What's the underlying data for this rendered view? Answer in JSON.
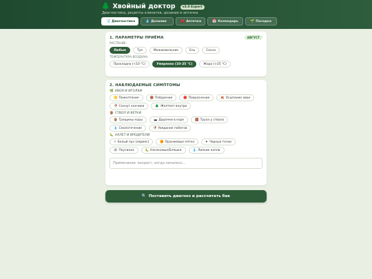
{
  "header": {
    "title": "Хвойный доктор",
    "version": "v3.0 Expert",
    "subtitle": "Диагностика, рецепты клинатов, дозание и аптечка"
  },
  "tabs": [
    {
      "icon": "🩺",
      "label": "Диагностика",
      "active": true
    },
    {
      "icon": "💧",
      "label": "Дозание"
    },
    {
      "icon": "🧰",
      "label": "Аптечка"
    },
    {
      "icon": "📅",
      "label": "Календарь"
    },
    {
      "icon": "🌱",
      "label": "Посадка"
    }
  ],
  "params": {
    "title": "1. ПАРАМЕТРЫ ПРИЁМА",
    "season_badge": "АВГУСТ",
    "plant_label": "РАСТЕНИЕ:",
    "plants": [
      "Любые",
      "Туя",
      "Можжевельник",
      "Ель",
      "Сосна"
    ],
    "temp_label": "ТЕМПЕРАТУРА ВОЗДУХА:",
    "temps": [
      "Прохладно (<10 °C)",
      "Умеренно (10–25 °C)",
      "Жара (>25 °C)"
    ]
  },
  "symptoms": {
    "title": "2. НАБЛЮДАЕМЫЕ СИМПТОМЫ",
    "needles_label": "ХВОЯ И ИГОЛКИ",
    "needles": [
      {
        "icon": "🟡",
        "label": "Пожелтение"
      },
      {
        "icon": "🟤",
        "label": "Побурение"
      },
      {
        "icon": "🔴",
        "label": "Покраснение"
      },
      {
        "icon": "🍂",
        "label": "Осыпание хвои"
      },
      {
        "icon": "🥀",
        "label": "Сохнут кончики"
      },
      {
        "icon": "🌲",
        "label": "Желтеет внутри"
      }
    ],
    "stem_label": "СТВОЛ И ВЕТКИ",
    "stem": [
      {
        "icon": "🪵",
        "label": "Трещины коры"
      },
      {
        "icon": "🕳️",
        "label": "Дырочки в коре"
      },
      {
        "icon": "🟫",
        "label": "Труха у ствола"
      },
      {
        "icon": "💧",
        "label": "Смолотечение"
      },
      {
        "icon": "🥀",
        "label": "Увядание побегов"
      }
    ],
    "pests_label": "НАЛЕТ И ВРЕДИТЕЛИ",
    "pests": [
      {
        "icon": "⚪",
        "label": "Белый пух (хермес)"
      },
      {
        "icon": "🟠",
        "label": "Оранжевые пятна"
      },
      {
        "icon": "⚫",
        "label": "Черные точки"
      },
      {
        "icon": "🕸️",
        "label": "Паутинка"
      },
      {
        "icon": "🐛",
        "label": "Насекомые/Бляшки"
      },
      {
        "icon": "💧",
        "label": "Липкие капли"
      }
    ],
    "note_placeholder": "Примечание: возраст, когда началось..."
  },
  "submit_label": "Поставить диагноз и рассчитать бак",
  "colors": {
    "primary": "#2f5d3a",
    "header": "#1f4a30",
    "background": "#e9efe3"
  }
}
